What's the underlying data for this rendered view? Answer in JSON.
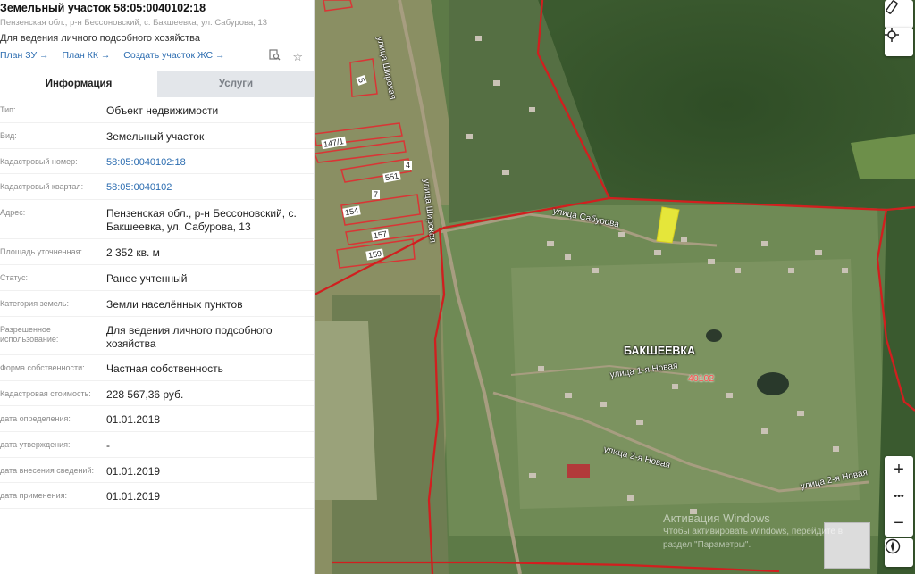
{
  "header": {
    "title": "Земельный участок 58:05:0040102:18",
    "address": "Пензенская обл., р-н Бессоновский, с. Бакшеевка, ул. Сабурова, 13",
    "use": "Для ведения личного подсобного хозяйства",
    "links": [
      "План ЗУ →",
      "План КК →",
      "Создать участок ЖС →"
    ],
    "icons": [
      "search-doc-icon",
      "star-icon"
    ]
  },
  "tabs": [
    {
      "label": "Информация",
      "active": true
    },
    {
      "label": "Услуги",
      "active": false
    }
  ],
  "rows": [
    {
      "label": "Тип:",
      "value": "Объект недвижимости",
      "link": false
    },
    {
      "label": "Вид:",
      "value": "Земельный участок",
      "link": false
    },
    {
      "label": "Кадастровый номер:",
      "value": "58:05:0040102:18",
      "link": true
    },
    {
      "label": "Кадастровый квартал:",
      "value": "58:05:0040102",
      "link": true
    },
    {
      "label": "Адрес:",
      "value": "Пензенская обл., р-н Бессоновский, с. Бакшеевка, ул. Сабурова, 13",
      "link": false
    },
    {
      "label": "Площадь уточненная:",
      "value": "2 352 кв. м",
      "link": false
    },
    {
      "label": "Статус:",
      "value": "Ранее учтенный",
      "link": false
    },
    {
      "label": "Категория земель:",
      "value": "Земли населённых пунктов",
      "link": false
    },
    {
      "label": "Разрешенное использование:",
      "value": "Для ведения личного подсобного хозяйства",
      "link": false
    },
    {
      "label": "Форма собственности:",
      "value": "Частная собственность",
      "link": false
    },
    {
      "label": "Кадастровая стоимость:",
      "value": "228 567,36 руб.",
      "link": false
    },
    {
      "label": "дата определения:",
      "value": "01.01.2018",
      "link": false
    },
    {
      "label": "дата утверждения:",
      "value": "-",
      "link": false
    },
    {
      "label": "дата внесения сведений:",
      "value": "01.01.2019",
      "link": false
    },
    {
      "label": "дата применения:",
      "value": "01.01.2019",
      "link": false
    }
  ],
  "map": {
    "streets": [
      "улица Широкая",
      "улица Сабурова",
      "улица 1-я Новая",
      "улица 2-я Новая",
      "улица 2-я Новая",
      "улица Широкая"
    ],
    "village": "БАКШЕЕВКА",
    "quarter": "40102",
    "parcels": [
      "147/1",
      "154",
      "157",
      "159",
      "551",
      "7",
      "4",
      "5"
    ],
    "controls": {
      "ruler": "ruler-icon",
      "locate": "locate-icon",
      "zoom_in": "+",
      "more": "•••",
      "zoom_out": "−",
      "compass": "compass-icon"
    },
    "watermark": {
      "line1": "Активация Windows",
      "line2": "Чтобы активировать Windows, перейдите в",
      "line3": "раздел \"Параметры\"."
    }
  }
}
